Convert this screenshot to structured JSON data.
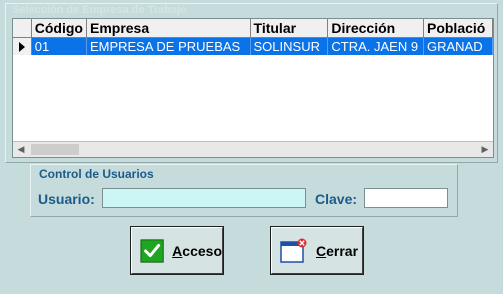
{
  "top_group": {
    "title": "Selección de Empresa de Trabajo"
  },
  "grid": {
    "columns": [
      "Código",
      "Empresa",
      "Titular",
      "Dirección",
      "Població"
    ],
    "rows": [
      [
        "01",
        "EMPRESA DE PRUEBAS",
        "SOLINSUR",
        "CTRA. JAEN 9",
        "GRANAD"
      ]
    ],
    "selected_row_color": "#0a73e8"
  },
  "users_group": {
    "title": "Control de Usuarios",
    "usuario_label": "Usuario:",
    "usuario_value": "",
    "clave_label": "Clave:",
    "clave_value": ""
  },
  "buttons": {
    "acceso_first": "A",
    "acceso_rest": "cceso",
    "cerrar_first": "C",
    "cerrar_rest": "errar"
  },
  "icons": {
    "acceso": "green-check-icon",
    "cerrar": "close-window-icon"
  }
}
